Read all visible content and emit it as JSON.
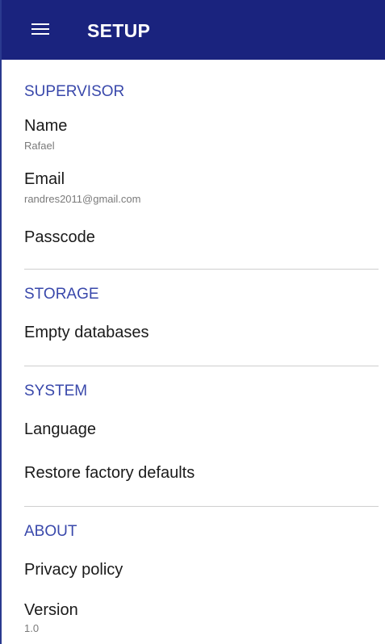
{
  "toolbar": {
    "title": "SETUP",
    "menu_icon": "hamburger-menu-icon",
    "background_color": "#1a237e"
  },
  "sections": {
    "supervisor": {
      "header": "SUPERVISOR",
      "name": {
        "title": "Name",
        "value": "Rafael"
      },
      "email": {
        "title": "Email",
        "value": "randres2011@gmail.com"
      },
      "passcode": {
        "title": "Passcode"
      }
    },
    "storage": {
      "header": "STORAGE",
      "empty_databases": {
        "title": "Empty databases"
      }
    },
    "system": {
      "header": "SYSTEM",
      "language": {
        "title": "Language"
      },
      "restore": {
        "title": "Restore factory defaults"
      }
    },
    "about": {
      "header": "ABOUT",
      "privacy": {
        "title": "Privacy policy"
      },
      "version": {
        "title": "Version",
        "value": "1.0"
      }
    }
  },
  "colors": {
    "accent": "#3948ab",
    "primary_text": "#1a1a1a",
    "secondary_text": "#7a7a7a",
    "divider": "#cfcfcf"
  }
}
